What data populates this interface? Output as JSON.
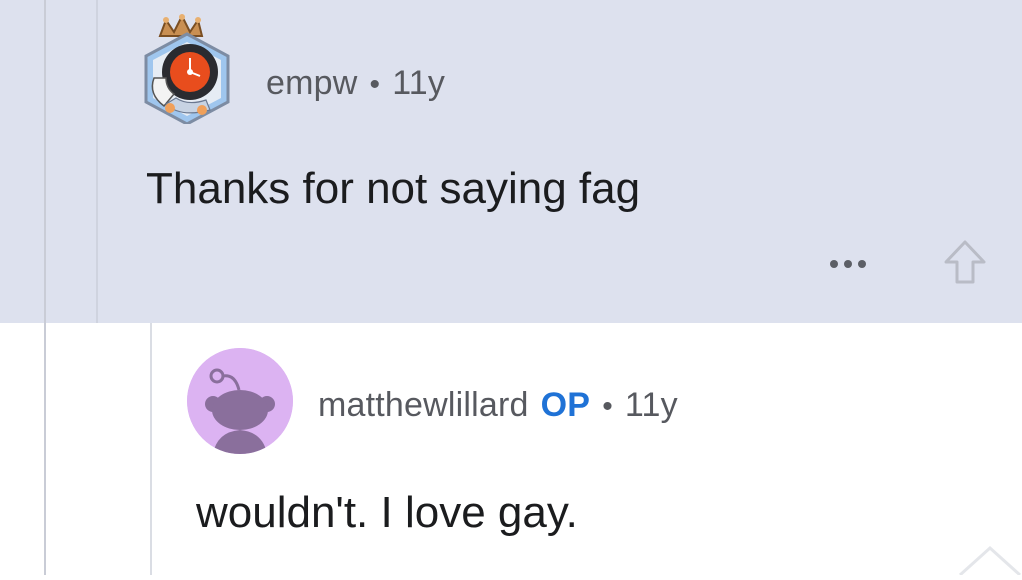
{
  "comments": [
    {
      "username": "empw",
      "separator": "•",
      "age": "11y",
      "body": "Thanks for not saying fag",
      "avatar_icon": "crowned-snoo-avatar-icon",
      "highlighted": true,
      "actions": {
        "more_icon": "more-dots-icon",
        "upvote_icon": "upvote-arrow-icon"
      }
    },
    {
      "username": "matthewlillard",
      "badge": "OP",
      "separator": "•",
      "age": "11y",
      "body": "wouldn't.  I love gay.",
      "avatar_icon": "default-snoo-avatar-icon"
    }
  ],
  "colors": {
    "highlight_bg": "#dde1ee",
    "op_badge": "#1f72d6",
    "meta_text": "#57595f",
    "body_text": "#1b1c1e",
    "default_avatar_bg": "#dcb3f2"
  }
}
